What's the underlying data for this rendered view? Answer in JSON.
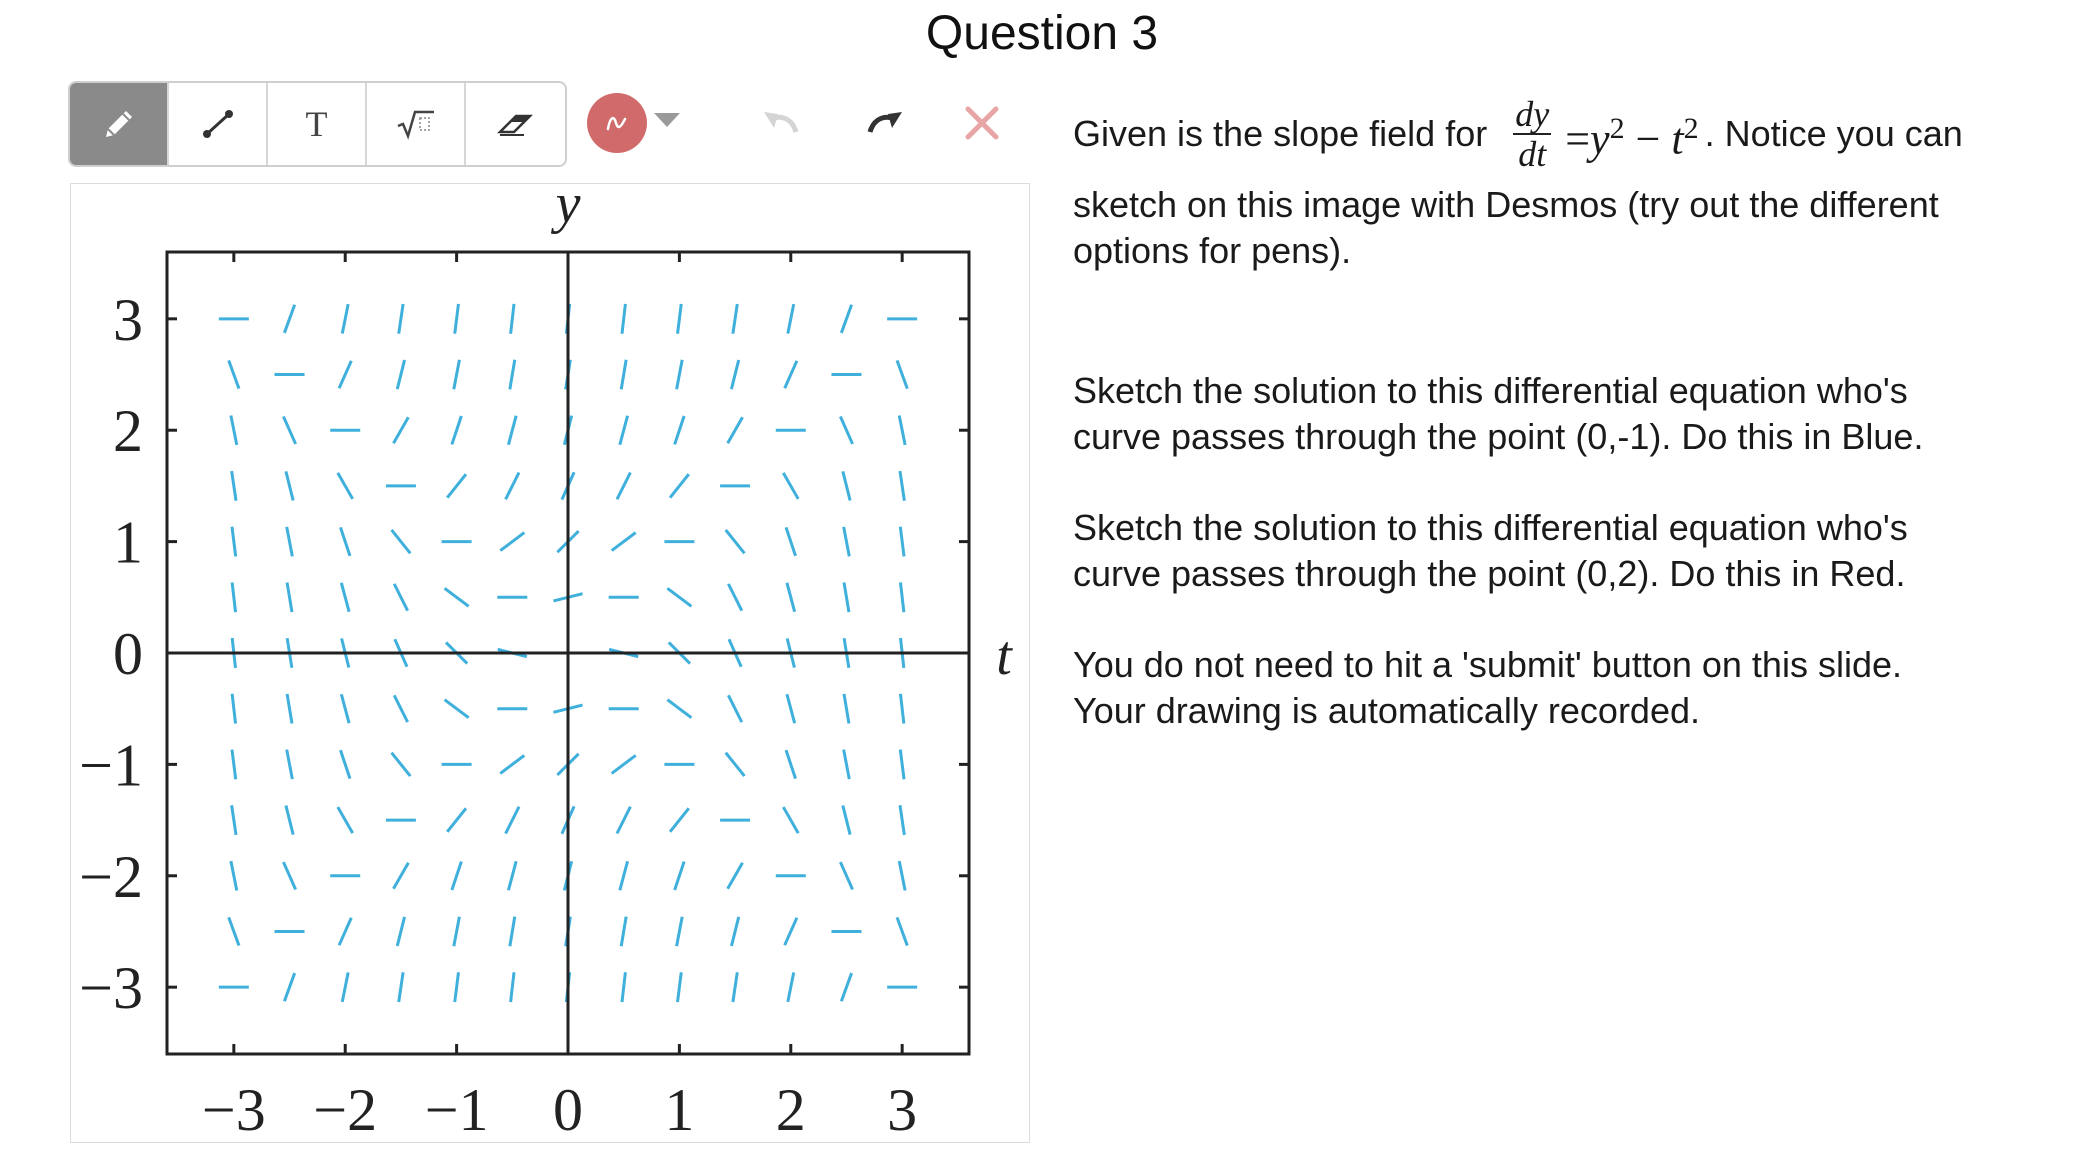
{
  "page": {
    "title": "Question 3"
  },
  "toolbar": {
    "tools": [
      {
        "name": "pen",
        "icon": "pencil-icon",
        "active": true
      },
      {
        "name": "line",
        "icon": "line-segment-icon",
        "active": false
      },
      {
        "name": "text",
        "icon": "text-icon",
        "label": "T",
        "active": false
      },
      {
        "name": "math",
        "icon": "math-sqrt-icon",
        "label": "√",
        "active": false
      },
      {
        "name": "eraser",
        "icon": "eraser-icon",
        "active": false
      }
    ],
    "pen_color": "#d16b6b",
    "undo_icon": "undo-icon",
    "redo_icon": "redo-icon",
    "clear_icon": "close-icon",
    "clear_color": "#e8a5a5"
  },
  "graph": {
    "x_label": "t",
    "y_label": "y",
    "x_ticks": [
      "−3",
      "−2",
      "−1",
      "0",
      "1",
      "2",
      "3"
    ],
    "y_ticks": [
      "3",
      "2",
      "1",
      "0",
      "−1",
      "−2",
      "−3"
    ],
    "field_color": "#3fb0dc"
  },
  "chart_data": {
    "type": "slope-field",
    "equation": "dy/dt = y^2 - t^2",
    "xlabel": "t",
    "ylabel": "y",
    "xlim": [
      -3.6,
      3.6
    ],
    "ylim": [
      -3.6,
      3.6
    ],
    "grid_step": 0.5,
    "grid_points_t": [
      -3,
      -2.5,
      -2,
      -1.5,
      -1,
      -0.5,
      0,
      0.5,
      1,
      1.5,
      2,
      2.5,
      3
    ],
    "grid_points_y": [
      -3,
      -2.5,
      -2,
      -1.5,
      -1,
      -0.5,
      0,
      0.5,
      1,
      1.5,
      2,
      2.5,
      3
    ]
  },
  "panel": {
    "intro_before": "Given is the slope field for",
    "eq_num": "dy",
    "eq_den": "dt",
    "eq_rest_eq": "=",
    "eq_y": "y",
    "eq_exp1": "2",
    "eq_minus": " − ",
    "eq_t": "t",
    "eq_exp2": "2",
    "intro_after": ". Notice you can",
    "intro_line2": "sketch on this image with Desmos (try out the different",
    "intro_line3": "options for pens).",
    "task1_line1": "Sketch the solution to this differential equation who's",
    "task1_line2": "curve passes through the point (0,-1). Do this in Blue.",
    "task2_line1": "Sketch the solution to this differential equation who's",
    "task2_line2": "curve passes through the point (0,2). Do this in Red.",
    "note_line1": "You do not need to hit a 'submit' button on this slide.",
    "note_line2": "Your drawing is automatically recorded."
  }
}
